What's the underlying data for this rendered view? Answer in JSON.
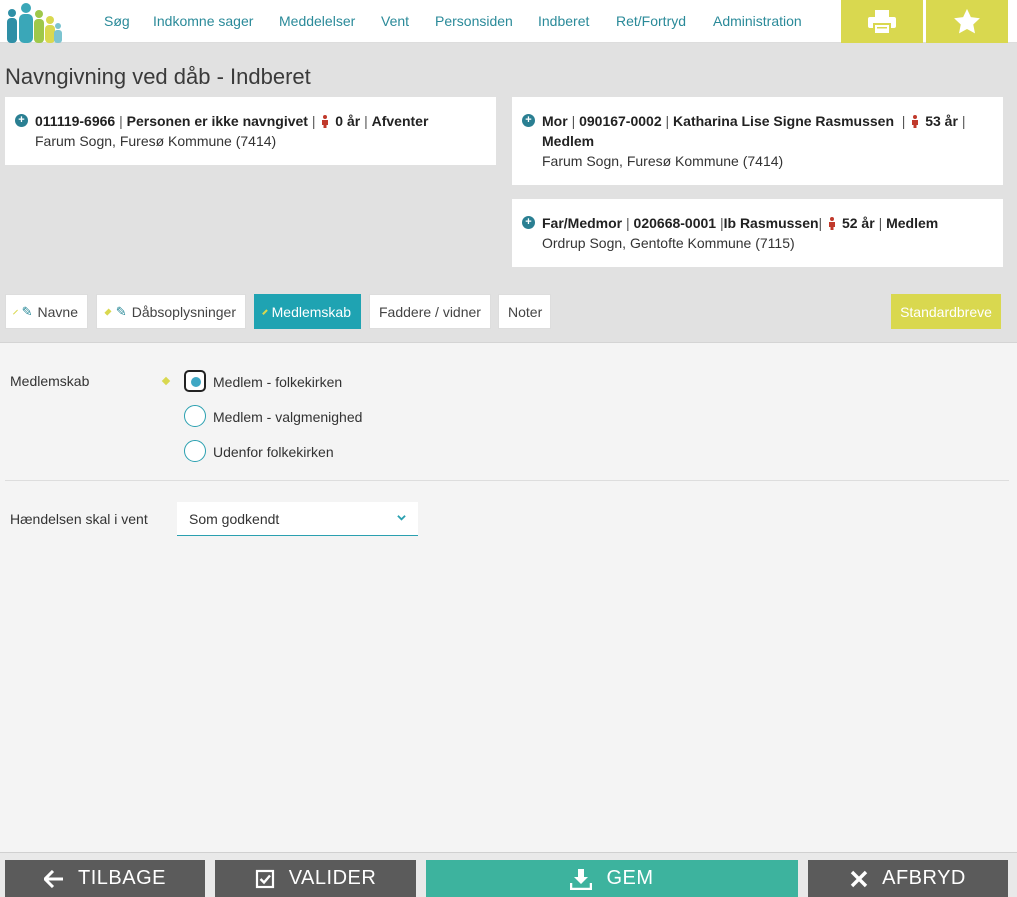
{
  "nav": {
    "items": [
      "Søg",
      "Indkomne sager",
      "Meddelelser",
      "Vent",
      "Personsiden",
      "Indberet",
      "Ret/Fortryd",
      "Administration"
    ]
  },
  "colors": {
    "accent": "#1fa3b2",
    "brand_yellow": "#d9d84f",
    "link": "#2a8a99",
    "dark_button": "#5b5b5b",
    "save_button": "#3db39e"
  },
  "page": {
    "title": "Navngivning ved dåb - Indberet"
  },
  "child_card": {
    "cpr": "011119-6966",
    "status": "Personen er ikke navngivet",
    "age": "0 år",
    "state": "Afventer",
    "parish": "Farum Sogn, Furesø Kommune (7414)"
  },
  "mother_card": {
    "role": "Mor",
    "cpr": "090167-0002",
    "name": "Katharina Lise Signe Rasmussen",
    "age": "53 år",
    "membership": "Medlem",
    "parish": "Farum Sogn, Furesø Kommune (7414)"
  },
  "father_card": {
    "role": "Far/Medmor",
    "cpr": "020668-0001",
    "name": "Ib Rasmussen",
    "age": "52 år",
    "membership": "Medlem",
    "parish": "Ordrup Sogn, Gentofte Kommune (7115)"
  },
  "tabs": {
    "names": "Navne",
    "baptism": "Dåbsoplysninger",
    "membership": "Medlemskab",
    "godparents": "Faddere / vidner",
    "notes": "Noter",
    "letters": "Standardbreve"
  },
  "form": {
    "membership_label": "Medlemskab",
    "options": [
      "Medlem - folkekirken",
      "Medlem - valgmenighed",
      "Udenfor folkekirken"
    ],
    "selected_option": "Medlem - folkekirken",
    "wait_label": "Hændelsen skal i vent",
    "wait_value": "Som godkendt"
  },
  "footer": {
    "back": "TILBAGE",
    "validate": "VALIDER",
    "save": "GEM",
    "cancel": "AFBRYD"
  }
}
